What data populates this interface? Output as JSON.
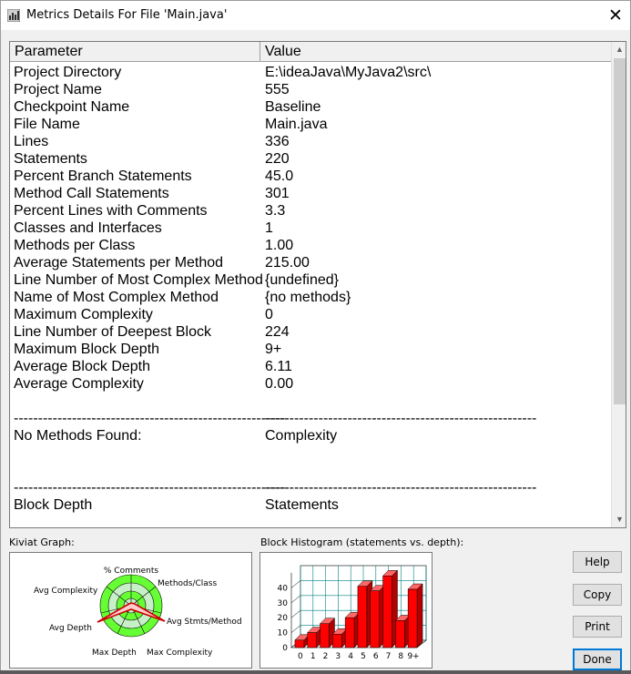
{
  "window": {
    "title": "Metrics Details For File 'Main.java'"
  },
  "table": {
    "headers": {
      "parameter": "Parameter",
      "value": "Value"
    },
    "rows": [
      {
        "p": "Project Directory",
        "v": "E:\\ideaJava\\MyJava2\\src\\"
      },
      {
        "p": "Project Name",
        "v": "555"
      },
      {
        "p": "Checkpoint Name",
        "v": "Baseline"
      },
      {
        "p": "File Name",
        "v": "Main.java"
      },
      {
        "p": "Lines",
        "v": "336"
      },
      {
        "p": "Statements",
        "v": "220"
      },
      {
        "p": "Percent Branch Statements",
        "v": "45.0"
      },
      {
        "p": "Method Call Statements",
        "v": "301"
      },
      {
        "p": "Percent Lines with Comments",
        "v": "3.3"
      },
      {
        "p": "Classes and Interfaces",
        "v": "1"
      },
      {
        "p": "Methods per Class",
        "v": "1.00"
      },
      {
        "p": "Average Statements per Method",
        "v": "215.00"
      },
      {
        "p": "Line Number of Most Complex Method",
        "v": "{undefined}"
      },
      {
        "p": "Name of Most Complex Method",
        "v": "{no methods}"
      },
      {
        "p": "Maximum Complexity",
        "v": "0"
      },
      {
        "p": "Line Number of Deepest Block",
        "v": "224"
      },
      {
        "p": "Maximum Block Depth",
        "v": "9+"
      },
      {
        "p": "Average Block Depth",
        "v": "6.11"
      },
      {
        "p": "Average Complexity",
        "v": "0.00"
      },
      {
        "p": "",
        "v": ""
      },
      {
        "p": "--------------------------------------------------------",
        "v": "--------------------------------------------------------"
      },
      {
        "p": "No Methods Found:",
        "v": "Complexity"
      },
      {
        "p": "",
        "v": ""
      },
      {
        "p": "",
        "v": ""
      },
      {
        "p": "--------------------------------------------------------",
        "v": "--------------------------------------------------------"
      },
      {
        "p": "Block Depth",
        "v": "Statements"
      }
    ]
  },
  "kiviat": {
    "label": "Kiviat Graph:",
    "axes": {
      "comments": "% Comments",
      "methods_class": "Methods/Class",
      "avg_stmts": "Avg Stmts/Method",
      "max_complexity": "Max Complexity",
      "max_depth": "Max Depth",
      "avg_depth": "Avg Depth",
      "avg_complexity": "Avg Complexity"
    }
  },
  "histogram": {
    "label": "Block Histogram (statements vs. depth):",
    "chart_data": {
      "type": "bar",
      "categories": [
        "0",
        "1",
        "2",
        "3",
        "4",
        "5",
        "6",
        "7",
        "8",
        "9+"
      ],
      "values": [
        5,
        10,
        16,
        9,
        20,
        41,
        38,
        48,
        18,
        39
      ],
      "yticks": [
        "0",
        "10",
        "20",
        "30",
        "40"
      ],
      "ylim": [
        0,
        50
      ],
      "bar_color": "#ff0000"
    }
  },
  "buttons": {
    "help": "Help",
    "copy": "Copy",
    "print": "Print",
    "done": "Done"
  }
}
